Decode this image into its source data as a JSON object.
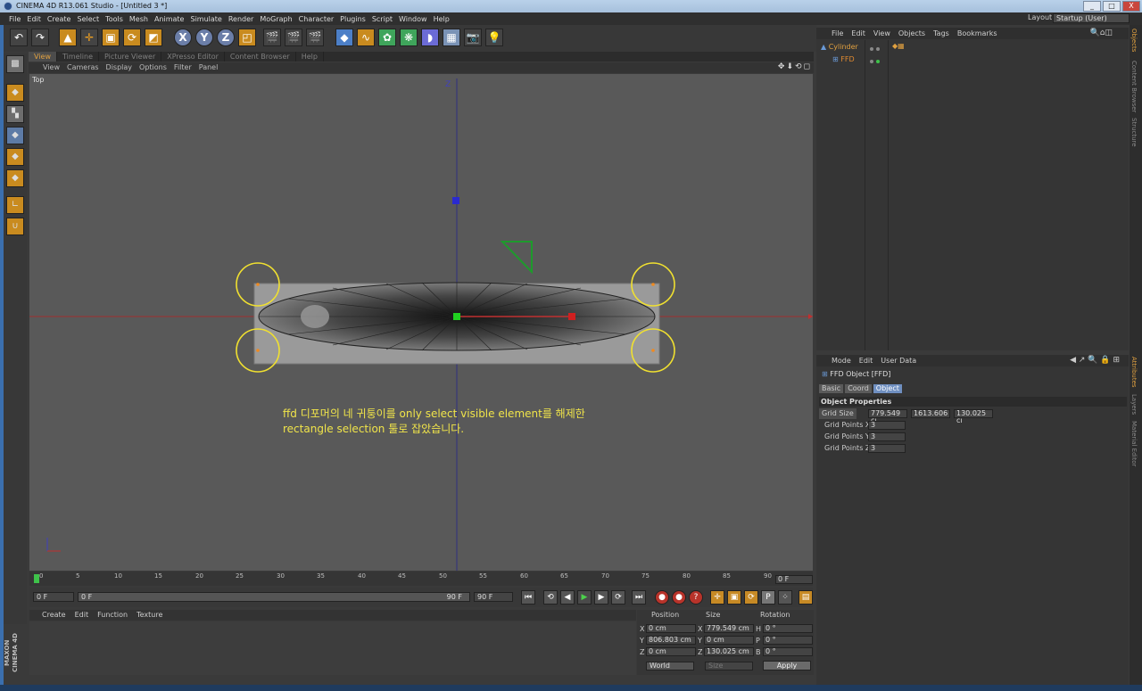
{
  "window": {
    "title": "CINEMA 4D R13.061 Studio - [Untitled 3 *]",
    "min": "_",
    "max": "□",
    "close": "X"
  },
  "menubar": [
    "File",
    "Edit",
    "Create",
    "Select",
    "Tools",
    "Mesh",
    "Animate",
    "Simulate",
    "Render",
    "MoGraph",
    "Character",
    "Plugins",
    "Script",
    "Window",
    "Help"
  ],
  "layout": {
    "label": "Layout:",
    "value": "Startup (User)"
  },
  "toolbar": {
    "undo": "↶",
    "redo": "↷",
    "x": "X",
    "y": "Y",
    "z": "Z"
  },
  "view_tabs": [
    "View",
    "Timeline",
    "Picture Viewer",
    "XPresso Editor",
    "Content Browser",
    "Help"
  ],
  "view_menu": [
    "View",
    "Cameras",
    "Display",
    "Options",
    "Filter",
    "Panel"
  ],
  "view_nav": "✥⬇⟲◻",
  "viewport": {
    "label": "Top",
    "axis_z": "Z",
    "annotation_line1": "ffd 디포머의 네 귀퉁이를 only select visible element를 해제한",
    "annotation_line2": "rectangle selection 툴로 잡았습니다.",
    "annotation_color": "#f0e44a"
  },
  "timeline": {
    "ticks": [
      "0",
      "5",
      "10",
      "15",
      "20",
      "25",
      "30",
      "35",
      "40",
      "45",
      "50",
      "55",
      "60",
      "65",
      "70",
      "75",
      "80",
      "85",
      "90"
    ],
    "current": "0 F"
  },
  "transport": {
    "start": "0 F",
    "slider_start": "0 F",
    "slider_end": "90 F",
    "end": "90 F"
  },
  "material_menu": [
    "Create",
    "Edit",
    "Function",
    "Texture"
  ],
  "coordinates": {
    "headers": {
      "position": "Position",
      "size": "Size",
      "rotation": "Rotation"
    },
    "rows": [
      {
        "axis": "X",
        "pos": "0 cm",
        "saxis": "X",
        "size": "779.549 cm",
        "raxis": "H",
        "rot": "0 °"
      },
      {
        "axis": "Y",
        "pos": "806.803 cm",
        "saxis": "Y",
        "size": "0 cm",
        "raxis": "P",
        "rot": "0 °"
      },
      {
        "axis": "Z",
        "pos": "0 cm",
        "saxis": "Z",
        "size": "130.025 cm",
        "raxis": "B",
        "rot": "0 °"
      }
    ],
    "world": "World",
    "size_mode": "Size",
    "apply": "Apply"
  },
  "object_manager": {
    "menu": [
      "File",
      "Edit",
      "View",
      "Objects",
      "Tags",
      "Bookmarks"
    ],
    "objects": [
      {
        "name": "Cylinder"
      },
      {
        "name": "FFD"
      }
    ]
  },
  "attribute_manager": {
    "menu": [
      "Mode",
      "Edit",
      "User Data"
    ],
    "title": "FFD Object [FFD]",
    "tabs": [
      "Basic",
      "Coord",
      "Object"
    ],
    "section": "Object Properties",
    "grid_size": {
      "label": "Grid Size",
      "x": "779.549 cı",
      "y": "1613.606",
      "z": "130.025 cı"
    },
    "grid_points_x": {
      "label": "Grid Points X",
      "value": "3"
    },
    "grid_points_y": {
      "label": "Grid Points Y",
      "value": "3"
    },
    "grid_points_z": {
      "label": "Grid Points Z",
      "value": "3"
    }
  },
  "side_tabs": {
    "top": [
      "Objects",
      "Content Browser",
      "Structure"
    ],
    "bottom": [
      "Attributes",
      "Layers",
      "Material Editor"
    ]
  },
  "logo": "MAXON CINEMA 4D"
}
